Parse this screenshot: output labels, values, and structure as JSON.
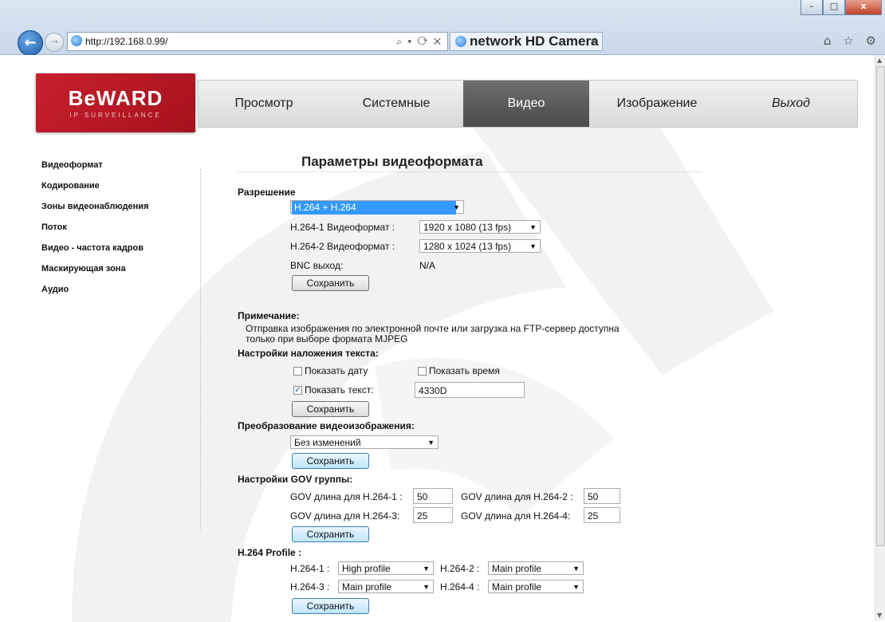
{
  "browser": {
    "url": "http://192.168.0.99/",
    "addr_controls": "⌕ ▾ ⟳ ✕",
    "tab_title": "network HD Camera",
    "tab_close": "×",
    "back_glyph": "←",
    "forward_glyph": "→",
    "window_buttons": {
      "min": "–",
      "max": "□",
      "close": "x"
    },
    "toolbar_icons": "⌂ ☆ ⚙"
  },
  "logo": {
    "brand": "BeWARD",
    "sub": "IP SURVEILLANCE"
  },
  "nav": {
    "items": [
      "Просмотр",
      "Системные",
      "Видео",
      "Изображение",
      "Выход"
    ],
    "active": "Видео"
  },
  "sidebar": {
    "items": [
      "Видеоформат",
      "Кодирование",
      "Зоны видеонаблюдения",
      "Поток",
      "Видео - частота кадров",
      "Маскирующая зона",
      "Аудио"
    ]
  },
  "main": {
    "title": "Параметры видеоформата",
    "resolution": {
      "label": "Разрешение",
      "value": "H.264 + H.264",
      "h1_label": "H.264-1 Видеоформат :",
      "h1_value": "1920 x 1080 (13 fps)",
      "h2_label": "H.264-2 Видеоформат :",
      "h2_value": "1280 x 1024 (13 fps)",
      "bnc_label": "BNC выход:",
      "bnc_value": "N/A",
      "save": "Сохранить"
    },
    "note": {
      "label": "Примечание:",
      "line1": "Отправка изображения по электронной почте или загрузка на FTP-сервер доступна",
      "line2": "только при выборе формата MJPEG"
    },
    "overlay": {
      "label": "Настройки наложения текста:",
      "show_date": "Показать дату",
      "show_date_checked": false,
      "show_time": "Показать время",
      "show_time_checked": false,
      "show_text": "Показать текст:",
      "show_text_checked": true,
      "text_value": "4330D",
      "save": "Сохранить"
    },
    "transform": {
      "label": "Преобразование видеоизображения:",
      "value": "Без изменений",
      "save": "Сохранить"
    },
    "gov": {
      "label": "Настройки GOV группы:",
      "g1_label": "GOV длина для H.264-1 :",
      "g1_value": "50",
      "g2_label": "GOV длина для H.264-2 :",
      "g2_value": "50",
      "g3_label": "GOV длина для H.264-3:",
      "g3_value": "25",
      "g4_label": "GOV длина для H.264-4:",
      "g4_value": "25",
      "save": "Сохранить"
    },
    "profile": {
      "label": "H.264 Profile :",
      "p1_label": "H.264-1 :",
      "p1_value": "High profile",
      "p2_label": "H.264-2 :",
      "p2_value": "Main profile",
      "p3_label": "H.264-3 :",
      "p3_value": "Main profile",
      "p4_label": "H.264-4 :",
      "p4_value": "Main profile",
      "save": "Сохранить"
    }
  },
  "colors": {
    "brand_red": "#c8202c",
    "nav_active": "#555555",
    "select_highlight": "#3399ff"
  }
}
